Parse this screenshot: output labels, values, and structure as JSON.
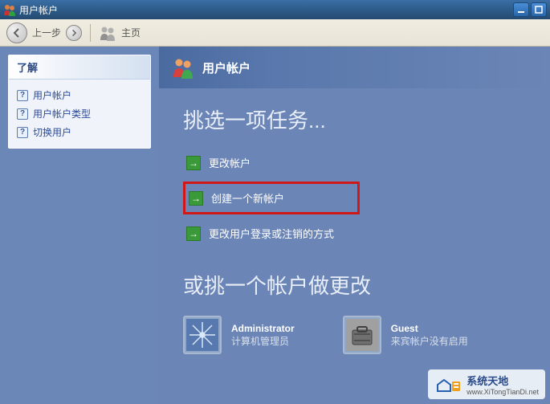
{
  "titlebar": {
    "title": "用户帐户"
  },
  "toolbar": {
    "back_label": "上一步",
    "home_label": "主页"
  },
  "sidebar": {
    "panel_title": "了解",
    "links": [
      {
        "label": "用户帐户"
      },
      {
        "label": "用户帐户类型"
      },
      {
        "label": "切换用户"
      }
    ]
  },
  "main": {
    "header_title": "用户帐户",
    "pick_task_heading": "挑选一项任务...",
    "tasks": [
      {
        "label": "更改帐户",
        "highlighted": false
      },
      {
        "label": "创建一个新帐户",
        "highlighted": true
      },
      {
        "label": "更改用户登录或注销的方式",
        "highlighted": false
      }
    ],
    "pick_account_heading": "或挑一个帐户做更改",
    "accounts": [
      {
        "name": "Administrator",
        "desc": "计算机管理员",
        "icon": "snowflake"
      },
      {
        "name": "Guest",
        "desc": "来宾帐户没有启用",
        "icon": "suitcase"
      }
    ]
  },
  "watermark": {
    "cn": "系统天地",
    "url": "www.XiTongTianDi.net"
  }
}
